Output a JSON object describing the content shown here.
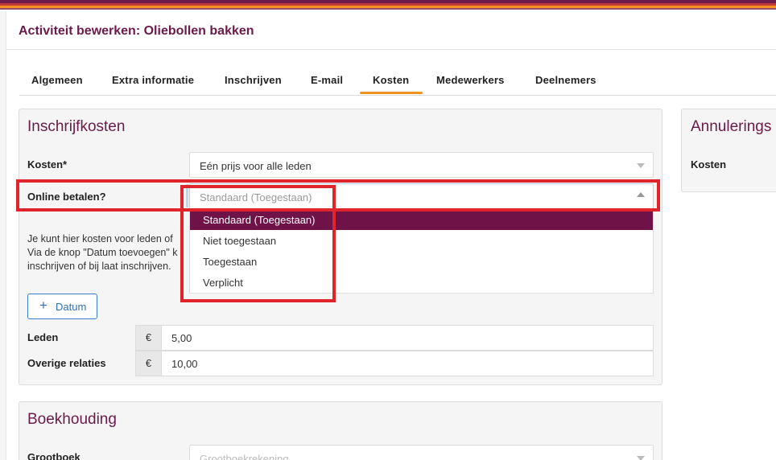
{
  "colors": {
    "brand": "#6b1a4a",
    "accent_orange": "#f0931f",
    "stripe_top": "#6e1b4c",
    "stripe_2": "#c23a3a",
    "stripe_3": "#f0931f",
    "stripe_4": "#9a4b6b",
    "selected_option_bg": "#6e1247",
    "highlight_red": "#e0242c",
    "link_blue": "#2f6fb8"
  },
  "header": {
    "title": "Activiteit bewerken: Oliebollen bakken"
  },
  "tabs": [
    {
      "label": "Algemeen"
    },
    {
      "label": "Extra informatie"
    },
    {
      "label": "Inschrijven"
    },
    {
      "label": "E-mail"
    },
    {
      "label": "Kosten",
      "active": true
    },
    {
      "label": "Medewerkers"
    },
    {
      "label": "Deelnemers"
    }
  ],
  "inschrijfkosten": {
    "title": "Inschrijfkosten",
    "kosten_label": "Kosten*",
    "kosten_value": "Eén prijs voor alle leden",
    "online_label": "Online betalen?",
    "online_placeholder": "Standaard (Toegestaan)",
    "dropdown_options": [
      {
        "label": "Standaard (Toegestaan)",
        "selected": true
      },
      {
        "label": "Niet toegestaan"
      },
      {
        "label": "Toegestaan"
      },
      {
        "label": "Verplicht"
      }
    ],
    "help_lines": [
      "Je kunt hier kosten voor leden of",
      "Via de knop \"Datum toevoegen\" k",
      "inschrijven of bij laat inschrijven."
    ],
    "datum_button": "Datum",
    "currency": "€",
    "rows": [
      {
        "label": "Leden",
        "value": "5,00"
      },
      {
        "label": "Overige relaties",
        "value": "10,00"
      }
    ]
  },
  "annulering": {
    "title": "Annulerings",
    "kosten_label": "Kosten"
  },
  "boekhouding": {
    "title": "Boekhouding",
    "grootboek_label": "Grootboek",
    "grootboek_placeholder": "Grootboekrekening"
  }
}
